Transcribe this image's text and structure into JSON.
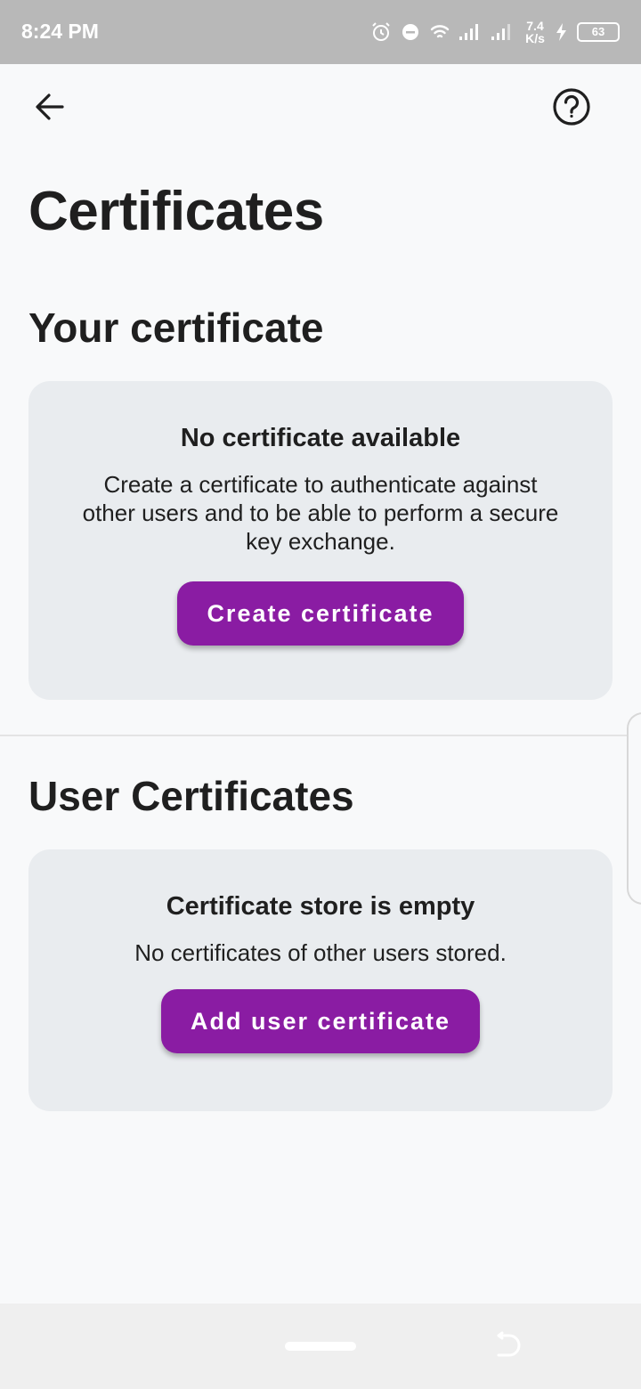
{
  "status_bar": {
    "time": "8:24 PM",
    "net_speed_value": "7.4",
    "net_speed_unit": "K/s",
    "battery": "63",
    "icons": [
      "alarm-icon",
      "do-not-disturb-icon",
      "wifi-icon",
      "signal-icon",
      "signal-icon",
      "charging-icon",
      "battery-icon"
    ]
  },
  "app_bar": {
    "back_icon": "arrow-left-icon",
    "help_icon": "help-circle-icon"
  },
  "page": {
    "title": "Certificates"
  },
  "your_certificate": {
    "section_title": "Your certificate",
    "card_title": "No certificate available",
    "card_body": "Create a certificate to authenticate against other users and to be able to perform a secure key exchange.",
    "button_label": "Create certificate"
  },
  "user_certificates": {
    "section_title": "User Certificates",
    "card_title": "Certificate store is empty",
    "card_body": "No certificates of other users stored.",
    "button_label": "Add user certificate"
  },
  "colors": {
    "accent": "#8a1ca3",
    "card_background": "#e9ecef",
    "page_background": "#f8f9fa",
    "status_bar": "#b8b8b8"
  }
}
